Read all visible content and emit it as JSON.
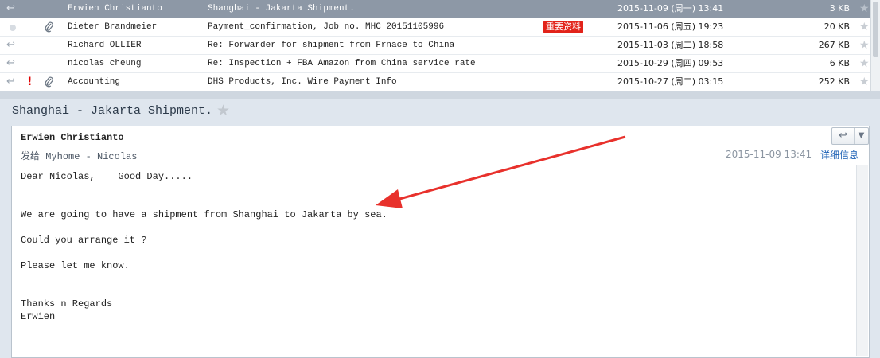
{
  "messages": [
    {
      "reply_icon": "reply-icon",
      "priority": "",
      "attachment": false,
      "sender": "Erwien Christianto",
      "subject": "Shanghai - Jakarta Shipment.",
      "tag": "",
      "date": "2015-11-09 (周一) 13:41",
      "size": "3 KB",
      "selected": true
    },
    {
      "reply_icon": "unread-dot",
      "priority": "",
      "attachment": true,
      "sender": "Dieter Brandmeier",
      "subject": "Payment_confirmation, Job no. MHC 20151105996",
      "tag": "重要资料",
      "date": "2015-11-06 (周五) 19:23",
      "size": "20 KB",
      "selected": false
    },
    {
      "reply_icon": "reply-icon",
      "priority": "",
      "attachment": false,
      "sender": "Richard OLLIER",
      "subject": "Re: Forwarder for shipment from Frnace to China",
      "tag": "",
      "date": "2015-11-03 (周二) 18:58",
      "size": "267 KB",
      "selected": false
    },
    {
      "reply_icon": "reply-icon",
      "priority": "",
      "attachment": false,
      "sender": "nicolas cheung",
      "subject": "Re: Inspection + FBA Amazon from China service rate",
      "tag": "",
      "date": "2015-10-29 (周四) 09:53",
      "size": "6 KB",
      "selected": false
    },
    {
      "reply_icon": "reply-icon",
      "priority": "!",
      "attachment": true,
      "sender": "Accounting",
      "subject": "DHS Products, Inc. Wire Payment Info",
      "tag": "",
      "date": "2015-10-27 (周二) 03:15",
      "size": "252 KB",
      "selected": false
    }
  ],
  "preview": {
    "title": "Shanghai - Jakarta Shipment.",
    "from": "Erwien Christianto",
    "to_label": "发给",
    "to": "Myhome - Nicolas",
    "date": "2015-11-09 13:41",
    "details_link": "详细信息",
    "body_lines": [
      "Dear Nicolas,    Good Day.....",
      "",
      "",
      "We are going to have a shipment from Shanghai to Jakarta by sea.",
      "",
      "Could you arrange it ?",
      "",
      "Please let me know.",
      "",
      "",
      "Thanks n Regards",
      "Erwien"
    ]
  },
  "icons": {
    "reply": "reply-icon",
    "star": "star-icon",
    "attachment": "paperclip-icon",
    "more": "chevron-down-icon"
  },
  "colors": {
    "selected_row": "#8d98a6",
    "tag_bg": "#e2231a",
    "link": "#1a5fb4",
    "arrow": "#e8312c"
  }
}
